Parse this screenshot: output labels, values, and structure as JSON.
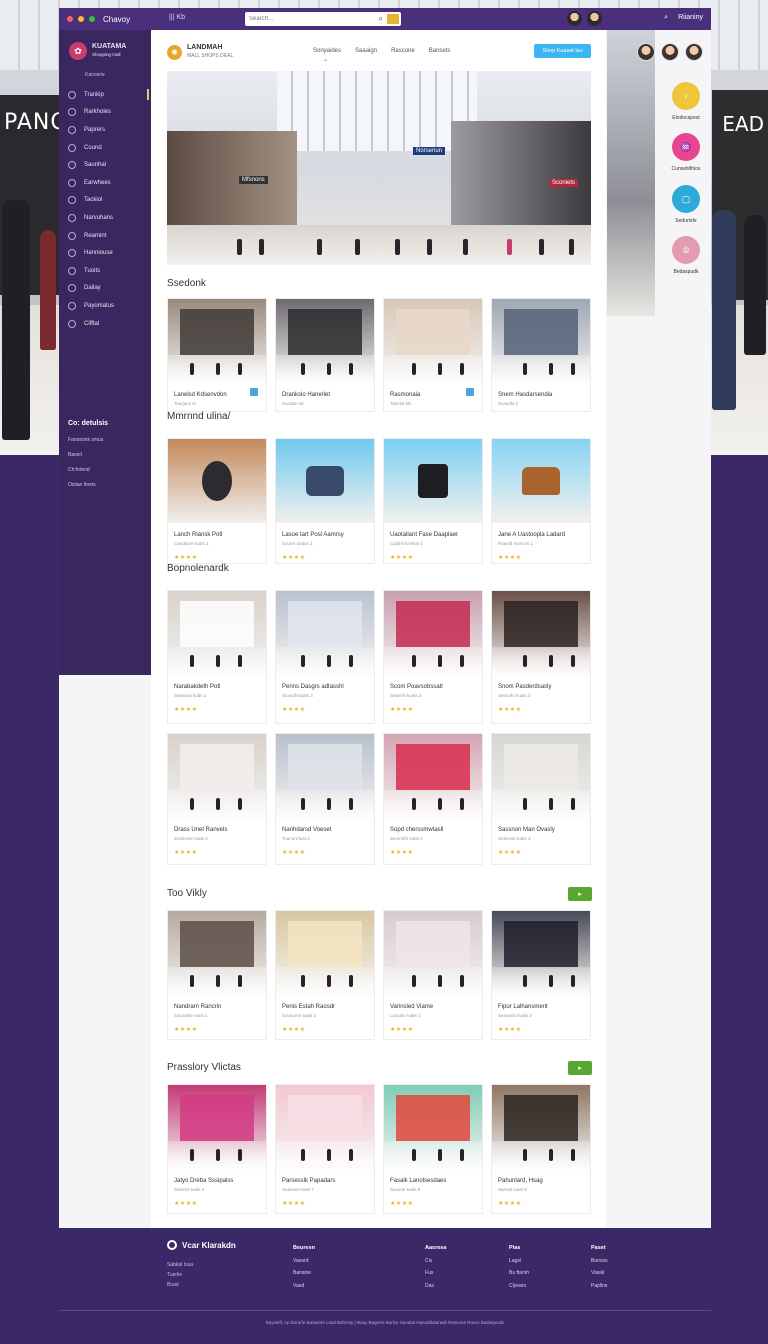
{
  "window": {
    "title": "Chavoy",
    "menu_label": "|||  Kb"
  },
  "search": {
    "placeholder": "Search..."
  },
  "topbar_right": {
    "search_symbol": "⌕",
    "user_label": "Riianiny"
  },
  "background": {
    "left_sign": "PANOI",
    "right_sign": "EAD"
  },
  "sidebar": {
    "logo_text": "KUATAMA",
    "logo_sub": "Shopping mall",
    "small_label": "Kanosrie",
    "items": [
      {
        "label": "Trankip"
      },
      {
        "label": "Rarkholes"
      },
      {
        "label": "Paprers"
      },
      {
        "label": "Cound"
      },
      {
        "label": "Saunhal"
      },
      {
        "label": "Earwhees"
      },
      {
        "label": "Tackiol"
      },
      {
        "label": "Narvuhans"
      },
      {
        "label": "Reamint"
      },
      {
        "label": "Hanniouse"
      },
      {
        "label": "Tuoits"
      },
      {
        "label": "Dailay"
      },
      {
        "label": "Payomatus"
      },
      {
        "label": "Cifftal"
      }
    ],
    "section_title": "Co: detulsis",
    "sub_items": [
      "Fanosonk smus",
      "Baserl",
      "Ch:fotend",
      "Oxtaw Itoets"
    ]
  },
  "header": {
    "brand_name": "LANDMAH",
    "brand_sub": "MALL SHOPS DEAL",
    "nav": [
      "Sonyaides",
      "Saaaign",
      "Rascone",
      "Bansets"
    ],
    "cta_label": "Shop Kuasat lau"
  },
  "hero": {
    "sign_center": "Norsenun",
    "sign_left": "Mfsnons",
    "sign_right": "Sconiets"
  },
  "sections": [
    {
      "title": "Ssedonk",
      "cards": [
        {
          "name": "Lanelsd Kdsenvdon",
          "sub": "Taurjaus ts"
        },
        {
          "name": "Drankslo Hanerlet",
          "sub": "Suodan sd"
        },
        {
          "name": "Rasmonaia",
          "sub": "Tanonk Mt"
        },
        {
          "name": "Snem Hasdarsendia",
          "sub": "Scaudlo 2"
        }
      ]
    },
    {
      "title": "Mmrnnd ulina/",
      "cards": [
        {
          "name": "Lanch Rlansk Potl",
          "sub": "Canduhre tuuts 1",
          "stars": "★★★★"
        },
        {
          "name": "Lasoe tart Posl Aamrsy",
          "sub": "Sounrt tuatus 1",
          "stars": "★★★★"
        },
        {
          "name": "Uaotallant Fase Daaplaer",
          "sub": "Caidnt ilvnstus 1",
          "stars": "★★★★"
        },
        {
          "name": "Jane A Uastoopla Ladard",
          "sub": "Ruandl muncns 1",
          "stars": "★★★★"
        }
      ]
    },
    {
      "title": "Bopnolenardk",
      "cards": [
        {
          "name": "Narabakdeth Potl",
          "sub": "Sealoma kuds 2",
          "stars": "★★★★"
        },
        {
          "name": "Penns Dasgrs adtasshl",
          "sub": "Scaudlt kuats 3",
          "stars": "★★★★"
        },
        {
          "name": "Scom Poavsobssatl",
          "sub": "Searmb kuats 3",
          "stars": "★★★★"
        },
        {
          "name": "Snom Pasderdsasly",
          "sub": "Semurlo kuats 3",
          "stars": "★★★★"
        }
      ]
    },
    {
      "title": "",
      "cards": [
        {
          "name": "Drass Unet Ranvels",
          "sub": "Scanome tuats 2",
          "stars": "★★★★"
        },
        {
          "name": "Nanhdarsd Voeset",
          "sub": "Tounonl lust 2",
          "stars": "★★★★"
        },
        {
          "name": "Sopd cherssmwtasll",
          "sub": "Seomnfo tuats 2",
          "stars": "★★★★"
        },
        {
          "name": "Sassnon Man Ovasly",
          "sub": "Seavone tuats 3",
          "stars": "★★★★"
        }
      ]
    },
    {
      "title": "Too Vikly",
      "button_symbol": "▸",
      "cards": [
        {
          "name": "Nandrarn Rancrin",
          "sub": "Sacuedte tuats 1",
          "stars": "★★★★"
        },
        {
          "name": "Penis Estah Raosdr",
          "sub": "Sounome tuats 2",
          "stars": "★★★★"
        },
        {
          "name": "Varinsled Viame",
          "sub": "Lucsam tuats 1",
          "stars": "★★★★"
        },
        {
          "name": "Fipur Lalhansment",
          "sub": "Seaundo kuats 2",
          "stars": "★★★★"
        }
      ]
    },
    {
      "title": "Prasslory Vlictas",
      "button_symbol": "▸",
      "cards": [
        {
          "name": "Jatyo Dreba Sssipalss",
          "sub": "Sarnhol tuats 4",
          "stars": "★★★★"
        },
        {
          "name": "Parsesslk Papadars",
          "sub": "Seanoor tuats 7",
          "stars": "★★★★"
        },
        {
          "name": "Fasalk Lanolsesdaes",
          "sub": "Suusotr tuats 5",
          "stars": "★★★★"
        },
        {
          "name": "Pahunlard, Hsag",
          "sub": "Sariost tuats 5",
          "stars": "★★★★"
        }
      ]
    }
  ],
  "right_panel": {
    "items": [
      {
        "label": "Elodocapest",
        "color": "#f1c53a",
        "symbol": "♀"
      },
      {
        "label": "Cunsetidhios",
        "color": "#e8458f",
        "symbol": "♒"
      },
      {
        "label": "Sedurtsfe",
        "color": "#2ea9d9",
        "symbol": "▢"
      },
      {
        "label": "Bedaspudk",
        "color": "#e39bb0",
        "symbol": "♔"
      }
    ]
  },
  "footer": {
    "brand": "Vcar Klarakdn",
    "info": [
      "Sabkal Isua",
      "Tuerlie",
      "Boad"
    ],
    "columns": [
      {
        "heading": "Beuresn",
        "items": [
          "Vaesrd",
          "Bansine",
          "Vaed"
        ]
      },
      {
        "heading": "Aasresa",
        "items": [
          "Cis",
          "Fus",
          "Das"
        ]
      },
      {
        "heading": "Plas",
        "items": [
          "Lagel",
          "Bu ftarsh",
          "Clyears"
        ]
      },
      {
        "heading": "Paset",
        "items": [
          "Bunoss",
          "Vlaskl",
          "Papllns"
        ]
      }
    ],
    "copyright": "Baysetfl, Ap Borurfe Basaetre  Lutal Bahnsty | Boay Bagerre Burlss Nonatal  Hanoddatarwdt  Ratsome Ronro Baslarpoals"
  }
}
